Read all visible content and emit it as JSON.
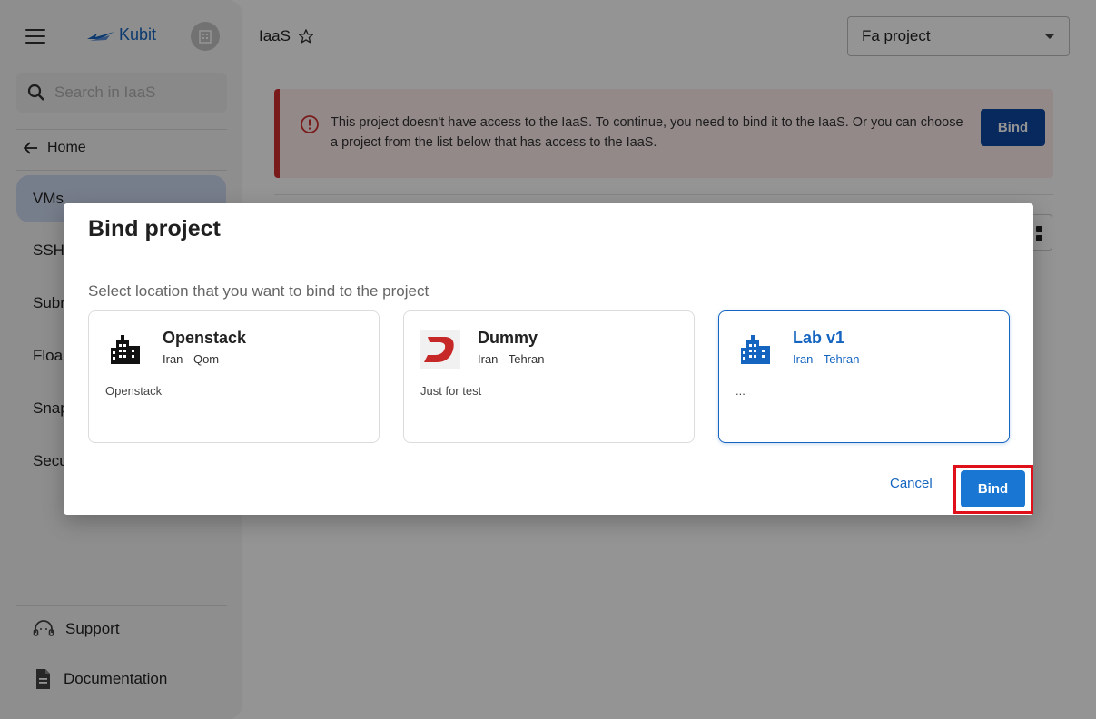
{
  "sidebar": {
    "logo_text": "Kubit",
    "search_placeholder": "Search in IaaS",
    "home_label": "Home",
    "nav_items": [
      {
        "label": "VMs",
        "active": true
      },
      {
        "label": "SSH"
      },
      {
        "label": "Subr"
      },
      {
        "label": "Floa"
      },
      {
        "label": "Snap"
      },
      {
        "label": "Secu"
      }
    ],
    "support_label": "Support",
    "documentation_label": "Documentation"
  },
  "header": {
    "title": "IaaS",
    "project_select_value": "Fa project"
  },
  "alert": {
    "message": "This project doesn't have access to the IaaS. To continue, you need to bind it to the IaaS. Or you can choose a project from the list below that has access to the IaaS.",
    "button_label": "Bind"
  },
  "dialog": {
    "title": "Bind project",
    "subtitle": "Select location that you want to bind to the project",
    "locations": [
      {
        "name": "Openstack",
        "location": "Iran - Qom",
        "description": "Openstack",
        "icon": "building-icon",
        "selected": false
      },
      {
        "name": "Dummy",
        "location": "Iran - Tehran",
        "description": "Just for test",
        "icon": "dummy-logo-icon",
        "selected": false
      },
      {
        "name": "Lab v1",
        "location": "Iran - Tehran",
        "description": "...",
        "icon": "building-icon",
        "selected": true
      }
    ],
    "cancel_label": "Cancel",
    "bind_label": "Bind"
  },
  "colors": {
    "primary": "#1976d2",
    "brand": "#1565c0",
    "alert_border": "#d32f2f",
    "alert_bg": "#fdecec",
    "highlight": "#e0101a"
  }
}
